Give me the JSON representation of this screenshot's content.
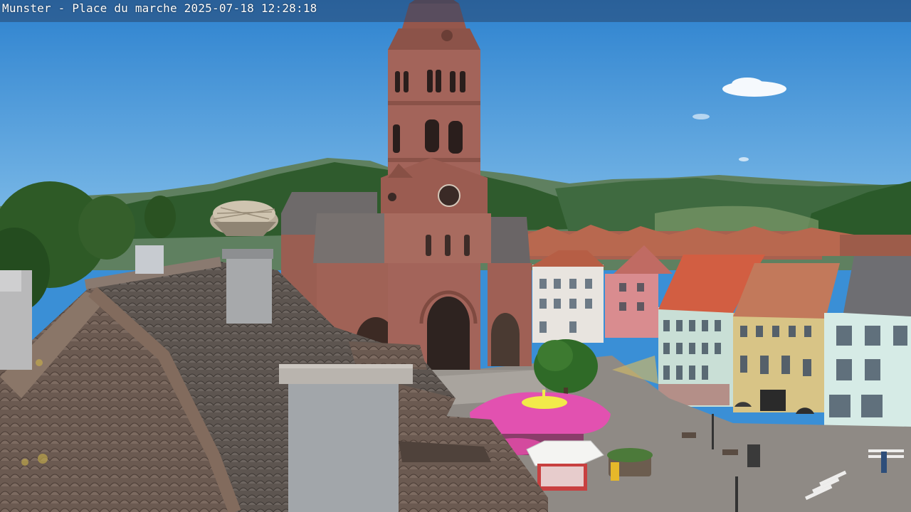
{
  "overlay": {
    "location": "Munster - Place du marche",
    "timestamp": "2025-07-18 12:28:18"
  },
  "colors": {
    "sky_top": "#2f86d2",
    "sky_bottom": "#6fb3e6",
    "mountain_far": "#5b7d64",
    "mountain_near": "#2f5a2c",
    "church_stone": "#9a5e52",
    "roof_tile": "#6e5a50",
    "umbrella": "#e04aa8",
    "plaza": "#8f8a85"
  },
  "scene_elements": [
    "sky",
    "cloud",
    "mountains",
    "church-tower",
    "church-nave",
    "storks-nest",
    "tiled-roof",
    "chimney",
    "town-houses",
    "pink-umbrella-kiosk",
    "market-stall",
    "tree",
    "plaza"
  ]
}
